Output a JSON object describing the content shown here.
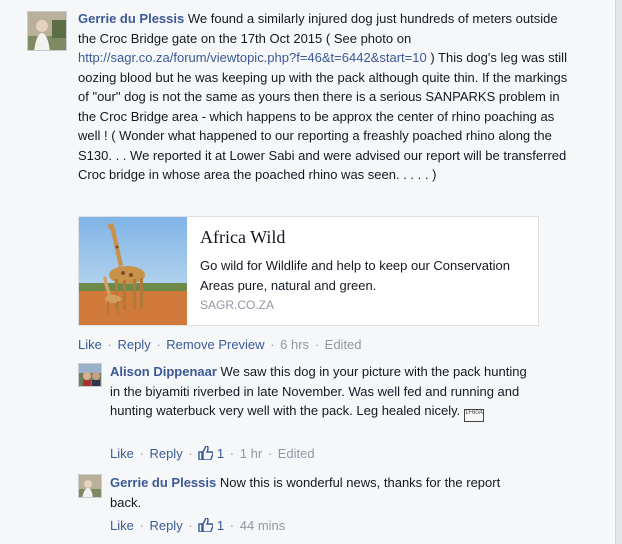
{
  "comments": [
    {
      "author": "Gerrie du Plessis",
      "text_part1": "We found a similarly injured dog just hundreds of meters outside the Croc Bridge gate on the 17th Oct 2015 ( See photo on",
      "link": "http://sagr.co.za/forum/viewtopic.php?f=46&t=6442&start=10",
      "text_part2": ") This dog's leg was still oozing blood but he was keeping up with the pack although quite thin. If the markings of \"our\" dog is not the same as yours then there is a serious SANPARKS problem in the Croc Bridge area - which happens to be approx the center of rhino poaching as well ! ( Wonder what happened to our reporting a freashly poached rhino along the S130. . . We reported it at Lower Sabi and were advised our report will be transferred Croc bridge in whose area the poached rhino was seen. . . . . )",
      "actions": {
        "like": "Like",
        "reply": "Reply",
        "remove_preview": "Remove Preview",
        "time": "6 hrs",
        "edited": "Edited"
      }
    }
  ],
  "link_preview": {
    "title": "Africa Wild",
    "description": "Go wild for Wildlife and help to keep our Conservation Areas pure, natural and green.",
    "domain": "SAGR.CO.ZA",
    "image_icon": "giraffe-photo"
  },
  "replies": [
    {
      "author": "Alison Dippenaar",
      "text": "We saw this dog in your picture with the pack hunting in the biyamiti riverbed in late November. Was well fed and running and hunting waterbuck very well with the pack. Leg healed nicely.",
      "emoji_code": "1F60A",
      "actions": {
        "like": "Like",
        "reply": "Reply",
        "like_count": "1",
        "time": "1 hr",
        "edited": "Edited"
      }
    },
    {
      "author": "Gerrie du Plessis",
      "text": "Now this is wonderful news, thanks for the report back.",
      "actions": {
        "like": "Like",
        "reply": "Reply",
        "like_count": "1",
        "time": "44 mins"
      }
    }
  ],
  "separator": "·",
  "colors": {
    "link": "#3b5998",
    "meta": "#9197a3",
    "background": "#f6f7f9"
  }
}
